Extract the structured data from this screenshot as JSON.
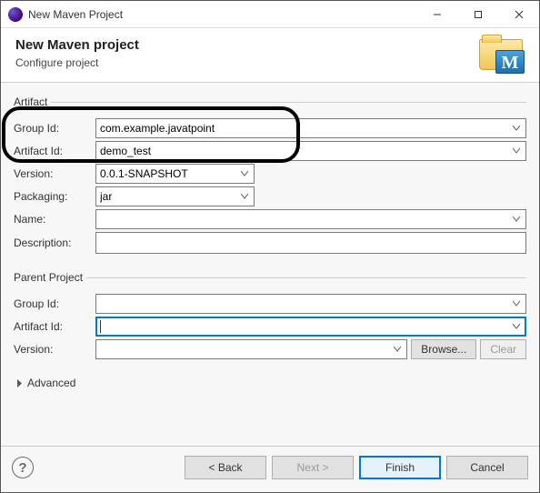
{
  "titlebar": {
    "title": "New Maven Project"
  },
  "header": {
    "title": "New Maven project",
    "subtitle": "Configure project"
  },
  "artifact": {
    "legend": "Artifact",
    "groupId": {
      "label": "Group Id:",
      "value": "com.example.javatpoint"
    },
    "artifactId": {
      "label": "Artifact Id:",
      "value": "demo_test"
    },
    "version": {
      "label": "Version:",
      "value": "0.0.1-SNAPSHOT"
    },
    "packaging": {
      "label": "Packaging:",
      "value": "jar"
    },
    "name": {
      "label": "Name:",
      "value": ""
    },
    "description": {
      "label": "Description:",
      "value": ""
    }
  },
  "parent": {
    "legend": "Parent Project",
    "groupId": {
      "label": "Group Id:",
      "value": ""
    },
    "artifactId": {
      "label": "Artifact Id:",
      "value": ""
    },
    "version": {
      "label": "Version:",
      "value": ""
    },
    "browse": "Browse...",
    "clear": "Clear"
  },
  "advanced": {
    "label": "Advanced"
  },
  "footer": {
    "back": "< Back",
    "next": "Next >",
    "finish": "Finish",
    "cancel": "Cancel"
  }
}
